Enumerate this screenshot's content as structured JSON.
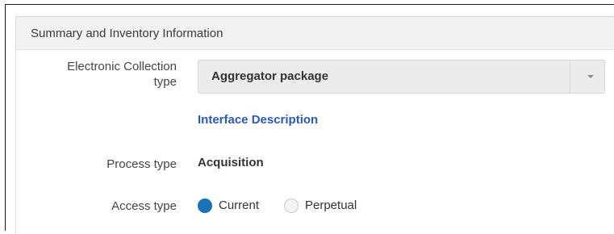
{
  "panel": {
    "title": "Summary and Inventory Information"
  },
  "fields": {
    "collection_type": {
      "label_line1": "Electronic Collection",
      "label_line2": "type",
      "value": "Aggregator package",
      "caret_icon": "chevron-down-icon"
    },
    "interface_link": "Interface Description",
    "process_type": {
      "label": "Process type",
      "value": "Acquisition"
    },
    "access_type": {
      "label": "Access type",
      "options": [
        {
          "label": "Current",
          "checked": true
        },
        {
          "label": "Perpetual",
          "checked": false
        }
      ]
    }
  },
  "colors": {
    "accent": "#1a73b5",
    "link": "#2a59b8",
    "header_bg": "#f2f2f2"
  }
}
